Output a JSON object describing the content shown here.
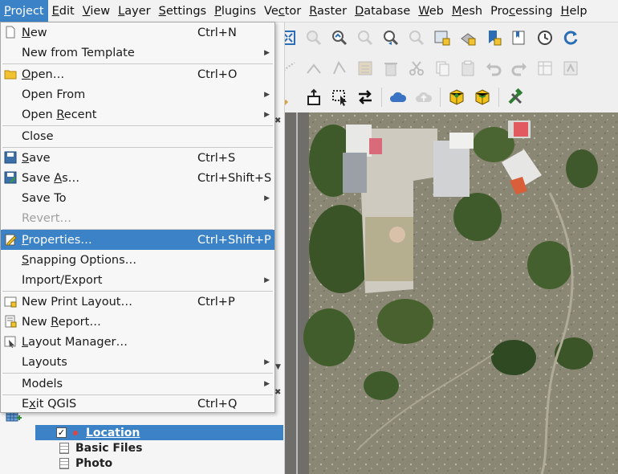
{
  "menubar": [
    {
      "label": "Project",
      "mnemonic": "P",
      "rest": "roject",
      "active": true
    },
    {
      "label": "Edit",
      "mnemonic": "E",
      "rest": "dit"
    },
    {
      "label": "View",
      "mnemonic": "V",
      "rest": "iew"
    },
    {
      "label": "Layer",
      "mnemonic": "L",
      "rest": "ayer"
    },
    {
      "label": "Settings",
      "mnemonic": "S",
      "rest": "ettings"
    },
    {
      "label": "Plugins",
      "mnemonic": "P",
      "rest": "lugins"
    },
    {
      "label": "Vector",
      "pre": "Ve",
      "mnemonic": "c",
      "rest": "tor"
    },
    {
      "label": "Raster",
      "mnemonic": "R",
      "rest": "aster"
    },
    {
      "label": "Database",
      "mnemonic": "D",
      "rest": "atabase"
    },
    {
      "label": "Web",
      "mnemonic": "W",
      "rest": "eb"
    },
    {
      "label": "Mesh",
      "mnemonic": "M",
      "rest": "esh"
    },
    {
      "label": "Processing",
      "pre": "Pro",
      "mnemonic": "c",
      "rest": "essing"
    },
    {
      "label": "Help",
      "mnemonic": "H",
      "rest": "elp"
    }
  ],
  "project_menu": {
    "new": {
      "label": "New",
      "m": "N",
      "rest": "ew",
      "shortcut": "Ctrl+N"
    },
    "new_from_template": {
      "label": "New from Template"
    },
    "open": {
      "label": "Open…",
      "m": "O",
      "rest": "pen…",
      "shortcut": "Ctrl+O"
    },
    "open_from": {
      "label": "Open From"
    },
    "open_recent": {
      "label": "Open Recent",
      "pre": "Open ",
      "m": "R",
      "rest": "ecent"
    },
    "close": {
      "label": "Close"
    },
    "save": {
      "label": "Save",
      "m": "S",
      "rest": "ave",
      "shortcut": "Ctrl+S"
    },
    "save_as": {
      "label": "Save As…",
      "pre": "Save ",
      "m": "A",
      "rest": "s…",
      "shortcut": "Ctrl+Shift+S"
    },
    "save_to": {
      "label": "Save To"
    },
    "revert": {
      "label": "Revert…"
    },
    "properties": {
      "label": "Properties…",
      "m": "P",
      "rest": "roperties…",
      "shortcut": "Ctrl+Shift+P"
    },
    "snapping": {
      "label": "Snapping Options…",
      "m": "S",
      "rest": "napping Options…"
    },
    "import_export": {
      "label": "Import/Export"
    },
    "new_print_layout": {
      "label": "New Print Layout…",
      "shortcut": "Ctrl+P"
    },
    "new_report": {
      "label": "New Report…",
      "pre": "New ",
      "m": "R",
      "rest": "eport…"
    },
    "layout_manager": {
      "label": "Layout Manager…",
      "m": "L",
      "rest": "ayout Manager…"
    },
    "layouts": {
      "label": "Layouts"
    },
    "models": {
      "label": "Models"
    },
    "exit": {
      "label": "Exit QGIS",
      "m": "x",
      "pre": "E",
      "rest": "it QGIS",
      "shortcut": "Ctrl+Q"
    }
  },
  "layers": [
    {
      "name": "Location",
      "checked": true,
      "selected": true
    },
    {
      "name": "Basic Files"
    },
    {
      "name": "Photo"
    }
  ],
  "colors": {
    "accent": "#3b83c6",
    "menu_bg": "#f7f7f7"
  }
}
